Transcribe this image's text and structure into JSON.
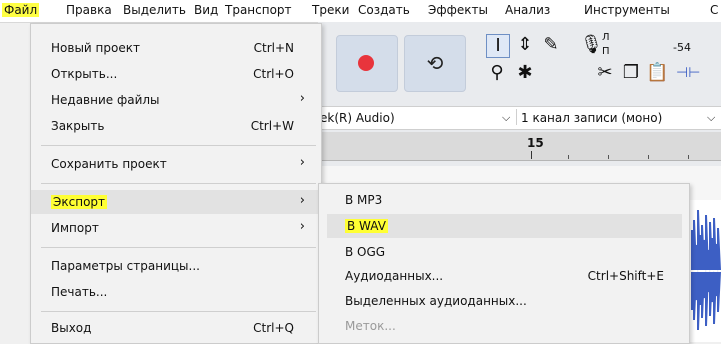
{
  "menubar": {
    "items": [
      "Файл",
      "Правка",
      "Выделить",
      "Вид",
      "Транспорт",
      "Треки",
      "Создать",
      "Эффекты",
      "Анализ",
      "Инструменты",
      "С"
    ]
  },
  "file_menu": {
    "items": [
      {
        "label": "Новый проект",
        "shortcut": "Ctrl+N"
      },
      {
        "label": "Открыть...",
        "shortcut": "Ctrl+O"
      },
      {
        "label": "Недавние файлы",
        "submenu_arrow": "›"
      },
      {
        "label": "Закрыть",
        "shortcut": "Ctrl+W"
      },
      {
        "label": "Сохранить проект",
        "submenu_arrow": "›"
      },
      {
        "label": "Экспорт",
        "submenu_arrow": "›"
      },
      {
        "label": "Импорт",
        "submenu_arrow": "›"
      },
      {
        "label": "Параметры страницы..."
      },
      {
        "label": "Печать..."
      },
      {
        "label": "Выход",
        "shortcut": "Ctrl+Q"
      }
    ]
  },
  "export_submenu": {
    "items": [
      {
        "label": "В MP3"
      },
      {
        "label": "В WAV"
      },
      {
        "label": "В OGG"
      },
      {
        "label": "Аудиоданных...",
        "shortcut": "Ctrl+Shift+E"
      },
      {
        "label": "Выделенных аудиоданных..."
      },
      {
        "label": "Меток..."
      }
    ]
  },
  "toolbar": {
    "meter_level": "-54",
    "meter_l": "Л",
    "meter_r": "П"
  },
  "device_bar": {
    "input_device": "ek(R) Audio)",
    "channels": "1 канал записи (моно)"
  },
  "timeline": {
    "marker": "15"
  },
  "colors": {
    "highlight": "#ffff33",
    "record": "#e8343c",
    "waveform": "#3d5fc4"
  }
}
